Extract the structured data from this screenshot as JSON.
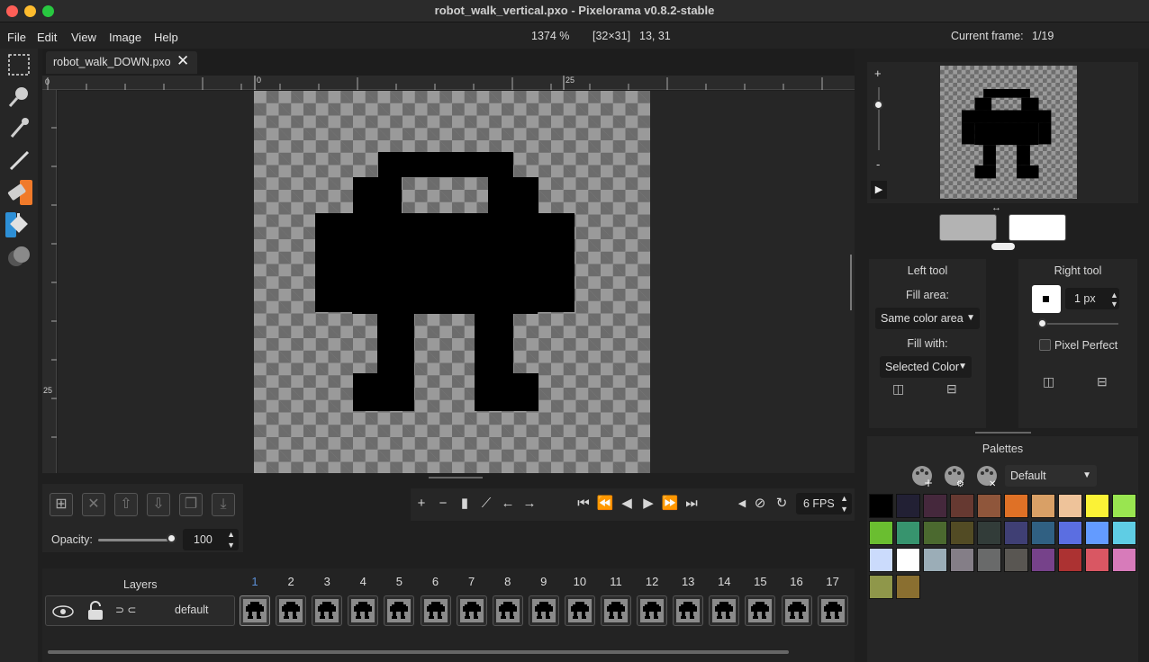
{
  "window": {
    "title": "robot_walk_vertical.pxo - Pixelorama v0.8.2-stable"
  },
  "menu": {
    "items": [
      "File",
      "Edit",
      "View",
      "Image",
      "Help"
    ]
  },
  "status": {
    "zoom": "1374 %",
    "size": "[32×31]",
    "cursor": "13, 31",
    "frame_label": "Current frame:",
    "frame_value": "1/19"
  },
  "tabs": [
    {
      "label": "robot_walk_DOWN.pxo"
    }
  ],
  "ruler": {
    "h_labels": [
      "0",
      "0",
      "25"
    ],
    "v_label": "25"
  },
  "layer_controls": {
    "opacity_label": "Opacity:",
    "opacity_value": "100"
  },
  "playback": {
    "fps": "6 FPS"
  },
  "timeline": {
    "layers_header": "Layers",
    "layer_name": "default",
    "frame_numbers": [
      "1",
      "2",
      "3",
      "4",
      "5",
      "6",
      "7",
      "8",
      "9",
      "10",
      "11",
      "12",
      "13",
      "14",
      "15",
      "16",
      "17"
    ]
  },
  "left_tool": {
    "header": "Left tool",
    "fill_area_label": "Fill area:",
    "fill_area_value": "Same color area",
    "fill_with_label": "Fill with:",
    "fill_with_value": "Selected Color"
  },
  "right_tool": {
    "header": "Right tool",
    "brush_size": "1 px",
    "pixel_perfect_label": "Pixel Perfect"
  },
  "preview": {
    "zoom_plus": "+",
    "zoom_minus": "-"
  },
  "palettes": {
    "header": "Palettes",
    "selected": "Default",
    "colors": [
      "#000000",
      "#222034",
      "#45283c",
      "#663931",
      "#8f563b",
      "#df7126",
      "#d9a066",
      "#eec39a",
      "#fbf236",
      "#99e550",
      "#6abe30",
      "#37946e",
      "#4b692f",
      "#524b24",
      "#323c39",
      "#3f3f74",
      "#306082",
      "#5b6ee1",
      "#639bff",
      "#5fcde4",
      "#cbdbfc",
      "#ffffff",
      "#9badb7",
      "#847e87",
      "#696a6a",
      "#595652",
      "#76428a",
      "#ac3232",
      "#d95763",
      "#d77bba",
      "#8f974a",
      "#8a6f30"
    ]
  },
  "colors": {
    "left_color": "#b3b3b3",
    "right_color": "#ffffff",
    "accent_orange": "#f07a2a",
    "accent_blue": "#2d8fd6"
  }
}
